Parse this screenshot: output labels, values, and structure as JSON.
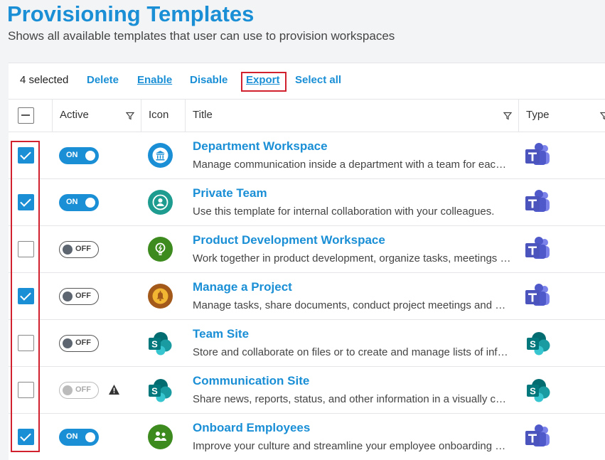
{
  "page": {
    "title": "Provisioning Templates",
    "subtitle": "Shows all available templates that user can use to provision workspaces"
  },
  "actionbar": {
    "selected_count": "4 selected",
    "delete_label": "Delete",
    "enable_label": "Enable",
    "disable_label": "Disable",
    "export_label": "Export",
    "select_all_label": "Select all"
  },
  "table": {
    "headers": {
      "active": "Active",
      "icon": "Icon",
      "title": "Title",
      "type": "Type"
    },
    "rows": [
      {
        "checked": true,
        "active": "ON",
        "warning": false,
        "icon": "bank-icon",
        "icon_color": "#1a8fd6",
        "title": "Department Workspace",
        "description": "Manage communication inside a department with a team for each department.",
        "type": "teams-icon"
      },
      {
        "checked": true,
        "active": "ON",
        "warning": false,
        "icon": "user-badge-icon",
        "icon_color": "#1e9c8f",
        "title": "Private Team",
        "description": "Use this template for internal collaboration with your colleagues.",
        "type": "teams-icon"
      },
      {
        "checked": false,
        "active": "OFF",
        "warning": false,
        "icon": "lightbulb-icon",
        "icon_color": "#3d8b1f",
        "title": "Product Development Workspace",
        "description": "Work together in product development, organize tasks, meetings and files.",
        "type": "teams-icon"
      },
      {
        "checked": true,
        "active": "OFF",
        "warning": false,
        "icon": "bell-icon",
        "icon_color": "#a3591a",
        "title": "Manage a Project",
        "description": "Manage tasks, share documents, conduct project meetings and more.",
        "type": "teams-icon"
      },
      {
        "checked": false,
        "active": "OFF",
        "warning": false,
        "icon": "sharepoint-icon",
        "icon_color": "#03787c",
        "title": "Team Site",
        "description": "Store and collaborate on files or to create and manage lists of information.",
        "type": "sharepoint-icon"
      },
      {
        "checked": false,
        "active": "OFF",
        "warning": true,
        "icon": "sharepoint-icon",
        "icon_color": "#03787c",
        "title": "Communication Site",
        "description": "Share news, reports, status, and other information in a visually compelling format.",
        "type": "sharepoint-icon"
      },
      {
        "checked": true,
        "active": "ON",
        "warning": false,
        "icon": "people-icon",
        "icon_color": "#3d8b1f",
        "title": "Onboard Employees",
        "description": "Improve your culture and streamline your employee onboarding process.",
        "type": "teams-icon"
      }
    ]
  },
  "colors": {
    "accent": "#1a8fd6",
    "highlight_red": "#d1202e",
    "teams_purple": "#5059c9",
    "sharepoint_teal": "#03787c"
  }
}
